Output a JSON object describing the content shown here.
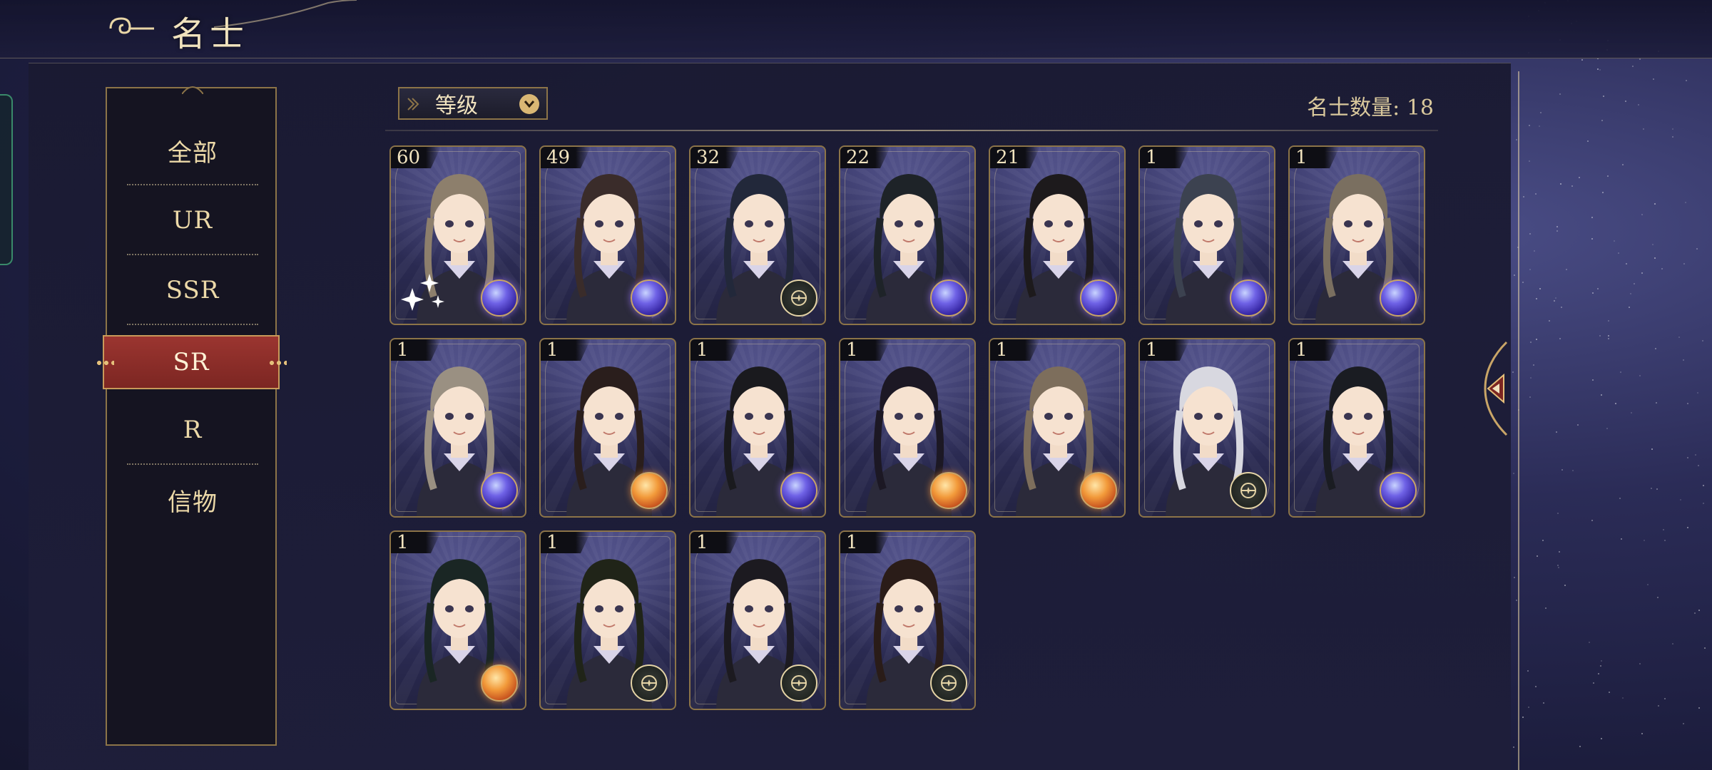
{
  "header": {
    "title": "名士"
  },
  "sidebar": {
    "items": [
      {
        "label": "全部",
        "active": false
      },
      {
        "label": "UR",
        "active": false
      },
      {
        "label": "SSR",
        "active": false
      },
      {
        "label": "SR",
        "active": true
      },
      {
        "label": "R",
        "active": false
      },
      {
        "label": "信物",
        "active": false
      }
    ]
  },
  "sort": {
    "label": "等级"
  },
  "count": {
    "label": "名士数量: 18"
  },
  "cards": [
    {
      "level": "60",
      "badge": "blue-orb",
      "hair": "#8d7f6c",
      "sparkles": true
    },
    {
      "level": "49",
      "badge": "blue-orb",
      "hair": "#3a2c2a"
    },
    {
      "level": "32",
      "badge": "compass",
      "hair": "#22283a"
    },
    {
      "level": "22",
      "badge": "blue-orb",
      "hair": "#1e2328"
    },
    {
      "level": "21",
      "badge": "blue-orb",
      "hair": "#1d1a1c"
    },
    {
      "level": "1",
      "badge": "blue-orb",
      "hair": "#3c4250"
    },
    {
      "level": "1",
      "badge": "blue-orb",
      "hair": "#7a6f60"
    },
    {
      "level": "1",
      "badge": "blue-orb",
      "hair": "#9a9082"
    },
    {
      "level": "1",
      "badge": "orange-orb",
      "hair": "#2a1e1c"
    },
    {
      "level": "1",
      "badge": "blue-orb",
      "hair": "#1a1a1e"
    },
    {
      "level": "1",
      "badge": "orange-orb",
      "hair": "#1c1824"
    },
    {
      "level": "1",
      "badge": "orange-orb",
      "hair": "#7d6e5c"
    },
    {
      "level": "1",
      "badge": "compass",
      "hair": "#d8d8e0"
    },
    {
      "level": "1",
      "badge": "blue-orb",
      "hair": "#1a1c22"
    },
    {
      "level": "1",
      "badge": "orange-orb",
      "hair": "#1a2624"
    },
    {
      "level": "1",
      "badge": "compass",
      "hair": "#202418"
    },
    {
      "level": "1",
      "badge": "compass",
      "hair": "#1c1a20"
    },
    {
      "level": "1",
      "badge": "compass",
      "hair": "#2a1c18"
    }
  ],
  "colors": {
    "accent_gold": "#e9d6a6",
    "frame_gold": "#8c7448",
    "active_red": "#9b3530",
    "panel_bg": "#1a1a32"
  }
}
